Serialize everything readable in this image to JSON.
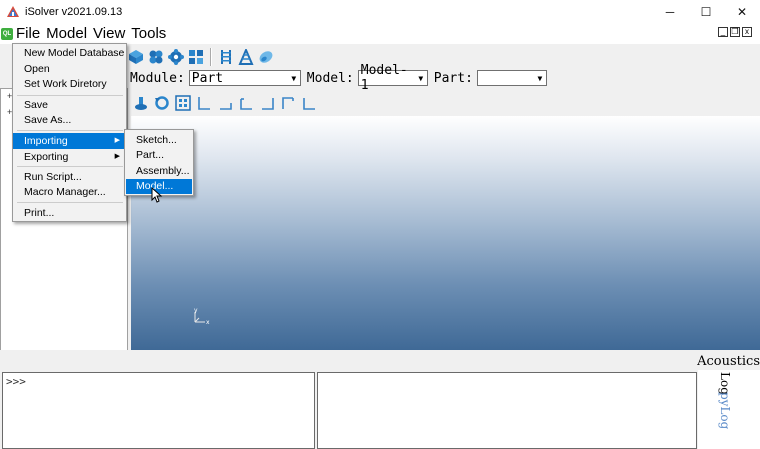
{
  "window": {
    "title": "iSolver v2021.09.13",
    "minimize_icon": "─",
    "maximize_icon": "☐",
    "close_icon": "✕"
  },
  "menubar": {
    "badge": "QL",
    "items": [
      {
        "label": "File"
      },
      {
        "label": "Model"
      },
      {
        "label": "View"
      },
      {
        "label": "Tools"
      }
    ]
  },
  "file_menu": {
    "items": [
      {
        "label": "New Model Database"
      },
      {
        "label": "Open"
      },
      {
        "label": "Set Work Diretory"
      },
      {
        "label": "Save"
      },
      {
        "label": "Save As..."
      },
      {
        "label": "Importing",
        "submenu": true
      },
      {
        "label": "Exporting",
        "submenu": true
      },
      {
        "label": "Run Script..."
      },
      {
        "label": "Macro Manager..."
      },
      {
        "label": "Print..."
      }
    ],
    "highlighted": "Importing"
  },
  "import_submenu": {
    "items": [
      {
        "label": "Sketch..."
      },
      {
        "label": "Part..."
      },
      {
        "label": "Assembly..."
      },
      {
        "label": "Model..."
      }
    ],
    "highlighted": "Model..."
  },
  "module_bar": {
    "module_label": "Module:",
    "module_value": "Part",
    "model_label": "Model:",
    "model_value": "Model-1",
    "part_label": "Part:",
    "part_value": ""
  },
  "console": {
    "prompt": ">>>"
  },
  "side_panel": {
    "title": "Acoustics",
    "tabs": [
      {
        "label": "Log"
      },
      {
        "label": "pyLog"
      }
    ]
  },
  "viewport": {
    "axis_x": "x",
    "axis_y": "y"
  },
  "colors": {
    "highlight": "#0078d7",
    "viewport_top": "#ffffff",
    "viewport_bottom": "#3f6996",
    "pylog": "#5a8ac8"
  }
}
